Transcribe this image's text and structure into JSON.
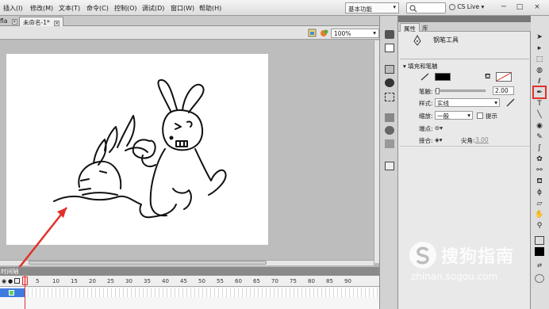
{
  "menu": {
    "items": [
      "插入(I)",
      "修改(M)",
      "文本(T)",
      "命令(C)",
      "控制(O)",
      "调试(D)",
      "窗口(W)",
      "帮助(H)"
    ],
    "workspace": "基本功能",
    "cs_live": "CS Live",
    "minimize": "─",
    "restore": "□",
    "close": "×"
  },
  "doc": {
    "tab_left": "fla",
    "tab_active": "未命名-1*",
    "close_glyph": "×",
    "zoom": "100%"
  },
  "timeline": {
    "panel_label": "时间轴",
    "frames": [
      "5",
      "10",
      "15",
      "20",
      "25",
      "30",
      "35",
      "40",
      "45",
      "50",
      "55",
      "60",
      "65",
      "70",
      "75",
      "80",
      "85",
      "90"
    ]
  },
  "properties": {
    "tabs": [
      "属性",
      "库"
    ],
    "tool_name": "钢笔工具",
    "section": "填充和笔触",
    "stroke_label": "笔触:",
    "stroke_value": "2.00",
    "style_label": "样式:",
    "style_value": "实线",
    "scale_label": "缩放:",
    "scale_value": "一般",
    "hint_label": "提示",
    "cap_label": "端点:",
    "join_label": "接合:",
    "miter_label": "尖角:",
    "miter_value": "3.00"
  },
  "watermark": {
    "brand": "搜狗指南",
    "url": "zhinan.sogou.com"
  },
  "colors": {
    "annotation_red": "#e2302b",
    "layer_blue": "#3d7be0",
    "stroke_color": "#000000"
  },
  "icons": [
    "selection-icon",
    "subselection-icon",
    "free-transform-icon",
    "3d-rotation-icon",
    "lasso-icon",
    "pen-icon",
    "text-icon",
    "line-icon",
    "rectangle-icon",
    "pencil-icon",
    "brush-icon",
    "deco-icon",
    "bone-icon",
    "paint-bucket-icon",
    "eyedropper-icon",
    "eraser-icon",
    "hand-icon",
    "zoom-icon"
  ]
}
